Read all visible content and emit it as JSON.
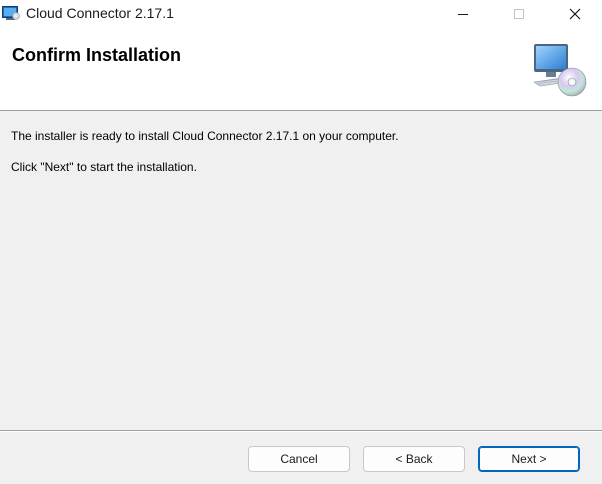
{
  "window": {
    "title": "Cloud Connector 2.17.1"
  },
  "header": {
    "title": "Confirm Installation",
    "icon": "computer-cd-install-icon"
  },
  "body": {
    "line1": "The installer is ready to install Cloud Connector 2.17.1 on your computer.",
    "line2": "Click \"Next\" to start the installation."
  },
  "buttons": {
    "cancel": "Cancel",
    "back": "< Back",
    "next": "Next >"
  },
  "colors": {
    "accent": "#0067c0",
    "background": "#f0f0f0",
    "header_bg": "#ffffff"
  }
}
